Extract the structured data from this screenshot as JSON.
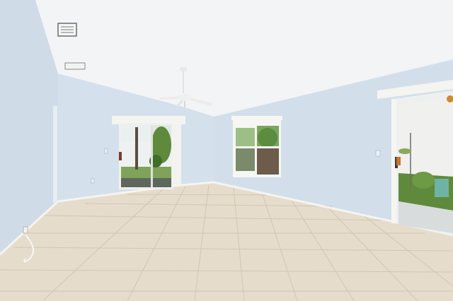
{
  "scene": {
    "kind": "photograph",
    "subject": "empty-room-interior",
    "colors": {
      "ceiling": "#f3f4f6",
      "left_wall": "#cfdce8",
      "back_wall": "#d4e0ec",
      "right_wall": "#d2dfeb",
      "floor": "#e6dccb",
      "grout": "#c9bea9",
      "glass_sky": "#e9f0f0",
      "foliage": "#5f8a3c",
      "trim": "#f4f4f1"
    },
    "icons": [
      "ceiling-fan-icon",
      "air-vent-icon",
      "outlet-icon",
      "hanging-planter-icon"
    ]
  }
}
